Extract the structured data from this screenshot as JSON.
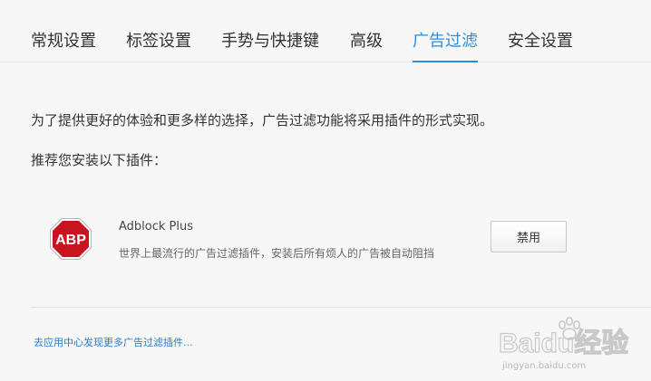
{
  "tabs": [
    {
      "label": "常规设置",
      "active": false
    },
    {
      "label": "标签设置",
      "active": false
    },
    {
      "label": "手势与快捷键",
      "active": false
    },
    {
      "label": "高级",
      "active": false
    },
    {
      "label": "广告过滤",
      "active": true
    },
    {
      "label": "安全设置",
      "active": false
    }
  ],
  "content": {
    "intro": "为了提供更好的体验和更多样的选择，广告过滤功能将采用插件的形式实现。",
    "recommend": "推荐您安装以下插件："
  },
  "plugin": {
    "icon": "abp-stop-sign-icon",
    "icon_text": "ABP",
    "name": "Adblock Plus",
    "description": "世界上最流行的广告过滤插件，安装后所有烦人的广告被自动阻挡",
    "button_label": "禁用"
  },
  "footer": {
    "link_text": "去应用中心发现更多广告过滤插件..."
  },
  "watermark": {
    "brand": "Baidu经验",
    "url": "jingyan.baidu.com"
  },
  "colors": {
    "accent": "#2a8fd8",
    "abp_red": "#c8141e",
    "link": "#2a7bc8"
  }
}
